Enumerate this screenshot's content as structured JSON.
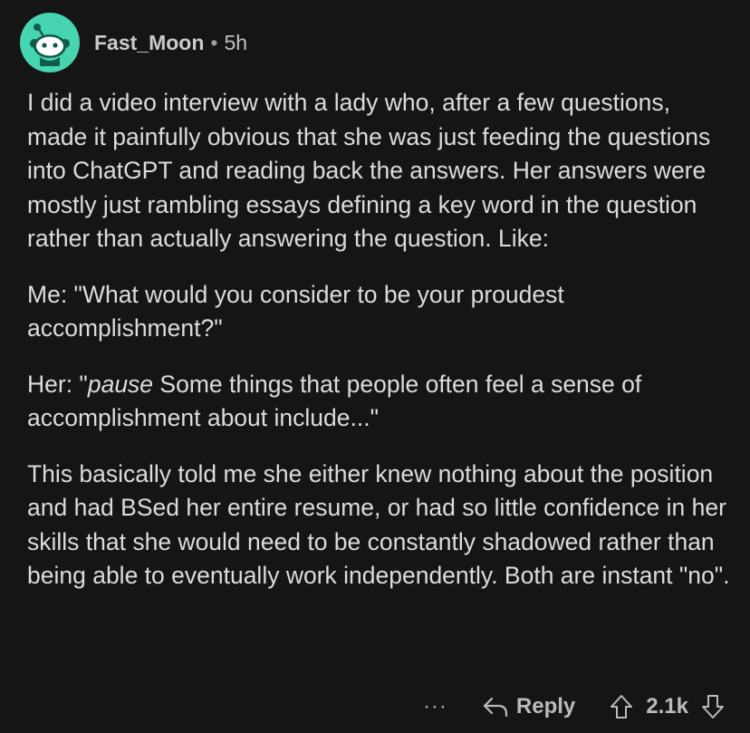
{
  "comment": {
    "author": "Fast_Moon",
    "separator": "•",
    "time": "5h",
    "paragraphs": [
      "I did a video interview with a lady who, after a few questions, made it painfully obvious that she was just feeding the questions into ChatGPT and reading back the answers. Her answers were mostly just rambling essays defining a key word in the question rather than actually answering the question. Like:",
      "Me: \"What would you consider to be your proudest accomplishment?\"",
      "This basically told me she either knew nothing about the position and had BSed her entire resume, or had so little confidence in her skills that she would need to be constantly shadowed rather than being able to eventually work independently. Both are instant \"no\"."
    ],
    "her_quote": {
      "prefix": "Her: \"",
      "italic": "pause",
      "rest": " Some things that people often feel a sense of accomplishment about include...\""
    }
  },
  "actions": {
    "more": "···",
    "reply_label": "Reply",
    "score": "2.1k"
  },
  "colors": {
    "background": "#151515",
    "avatar": "#47d4b0",
    "text": "#dadcde"
  },
  "icons": {
    "avatar": "reddit-snoo-icon",
    "reply": "reply-arrow-icon",
    "upvote": "upvote-arrow-icon",
    "downvote": "downvote-arrow-icon"
  }
}
